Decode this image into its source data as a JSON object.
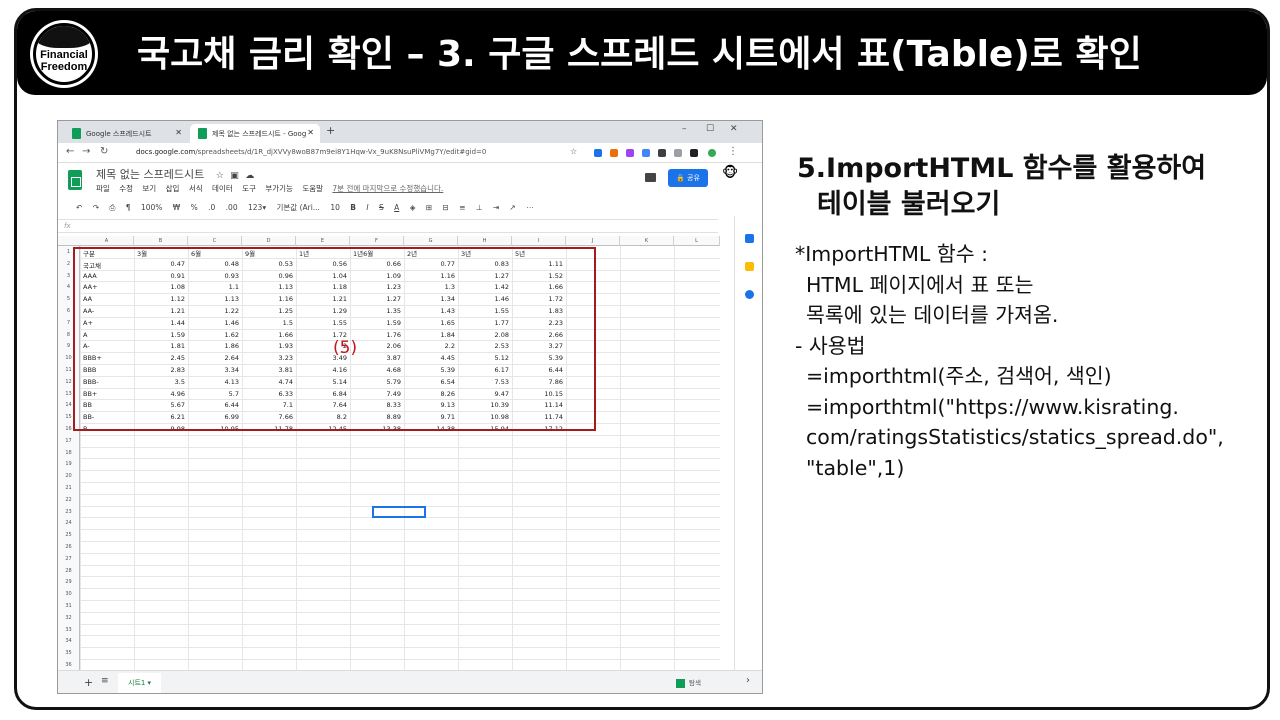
{
  "banner": {
    "title": "국고채 금리 확인 – 3. 구글 스프레드 시트에서 표(Table)로 확인",
    "logo_line1": "Financial",
    "logo_line2": "Freedom"
  },
  "browser": {
    "tabs": [
      {
        "label": "Google 스프레드시트"
      },
      {
        "label": "제목 없는 스프레드시트 - Goog"
      }
    ],
    "url_host": "docs.google.com",
    "url_path": "/spreadsheets/d/1R_djXVVy8woB87m9ei8Y1Hqw-Vx_9uK8NsuPliVMg7Y/edit#gid=0"
  },
  "sheets": {
    "doc_title": "제목 없는 스프레드시트",
    "menu": [
      "파일",
      "수정",
      "보기",
      "삽입",
      "서식",
      "데이터",
      "도구",
      "부가기능",
      "도움말"
    ],
    "last_edit": "7분 전에 마지막으로 수정했습니다.",
    "share_label": "공유",
    "toolbar": [
      "100%",
      "₩",
      "%",
      ".0",
      ".00",
      "123▾",
      "기본값 (Ari...",
      "10",
      "B",
      "I",
      "S",
      "A"
    ],
    "fx": "fx",
    "col_letters": [
      "A",
      "B",
      "C",
      "D",
      "E",
      "F",
      "G",
      "H",
      "I",
      "J",
      "K",
      "L"
    ],
    "header": [
      "구분",
      "3월",
      "6월",
      "9월",
      "1년",
      "1년6월",
      "2년",
      "3년",
      "5년"
    ],
    "rows": [
      [
        "국고채",
        "0.47",
        "0.48",
        "0.53",
        "0.56",
        "0.66",
        "0.77",
        "0.83",
        "1.11"
      ],
      [
        "AAA",
        "0.91",
        "0.93",
        "0.96",
        "1.04",
        "1.09",
        "1.16",
        "1.27",
        "1.52"
      ],
      [
        "AA+",
        "1.08",
        "1.1",
        "1.13",
        "1.18",
        "1.23",
        "1.3",
        "1.42",
        "1.66"
      ],
      [
        "AA",
        "1.12",
        "1.13",
        "1.16",
        "1.21",
        "1.27",
        "1.34",
        "1.46",
        "1.72"
      ],
      [
        "AA-",
        "1.21",
        "1.22",
        "1.25",
        "1.29",
        "1.35",
        "1.43",
        "1.55",
        "1.83"
      ],
      [
        "A+",
        "1.44",
        "1.46",
        "1.5",
        "1.55",
        "1.59",
        "1.65",
        "1.77",
        "2.23"
      ],
      [
        "A",
        "1.59",
        "1.62",
        "1.66",
        "1.72",
        "1.76",
        "1.84",
        "2.08",
        "2.66"
      ],
      [
        "A-",
        "1.81",
        "1.86",
        "1.93",
        "2",
        "2.06",
        "2.2",
        "2.53",
        "3.27"
      ],
      [
        "BBB+",
        "2.45",
        "2.64",
        "3.23",
        "3.49",
        "3.87",
        "4.45",
        "5.12",
        "5.39"
      ],
      [
        "BBB",
        "2.83",
        "3.34",
        "3.81",
        "4.16",
        "4.68",
        "5.39",
        "6.17",
        "6.44"
      ],
      [
        "BBB-",
        "3.5",
        "4.13",
        "4.74",
        "5.14",
        "5.79",
        "6.54",
        "7.53",
        "7.86"
      ],
      [
        "BB+",
        "4.96",
        "5.7",
        "6.33",
        "6.84",
        "7.49",
        "8.26",
        "9.47",
        "10.15"
      ],
      [
        "BB",
        "5.67",
        "6.44",
        "7.1",
        "7.64",
        "8.33",
        "9.13",
        "10.39",
        "11.14"
      ],
      [
        "BB-",
        "6.21",
        "6.99",
        "7.66",
        "8.2",
        "8.89",
        "9.71",
        "10.98",
        "11.74"
      ],
      [
        "B",
        "9.98",
        "10.95",
        "11.78",
        "12.45",
        "13.38",
        "14.38",
        "15.94",
        "17.12"
      ]
    ],
    "row_count": 36,
    "annotation": "(5)",
    "sheet_tab": "시트1 ▾",
    "explore_label": "탐색"
  },
  "right": {
    "title_line1": "5.ImportHTML 함수를 활용하여",
    "title_line2": "테이블 불러오기",
    "lines": [
      "*ImportHTML 함수 :",
      "HTML 페이지에서 표 또는",
      "목록에 있는 데이터를 가져옴.",
      "- 사용법",
      "=importhtml(주소, 검색어, 색인)",
      "=importhtml(\"https://www.kisrating.",
      "com/ratingsStatistics/statics_spread.do\",",
      "\"table\",1)"
    ]
  }
}
